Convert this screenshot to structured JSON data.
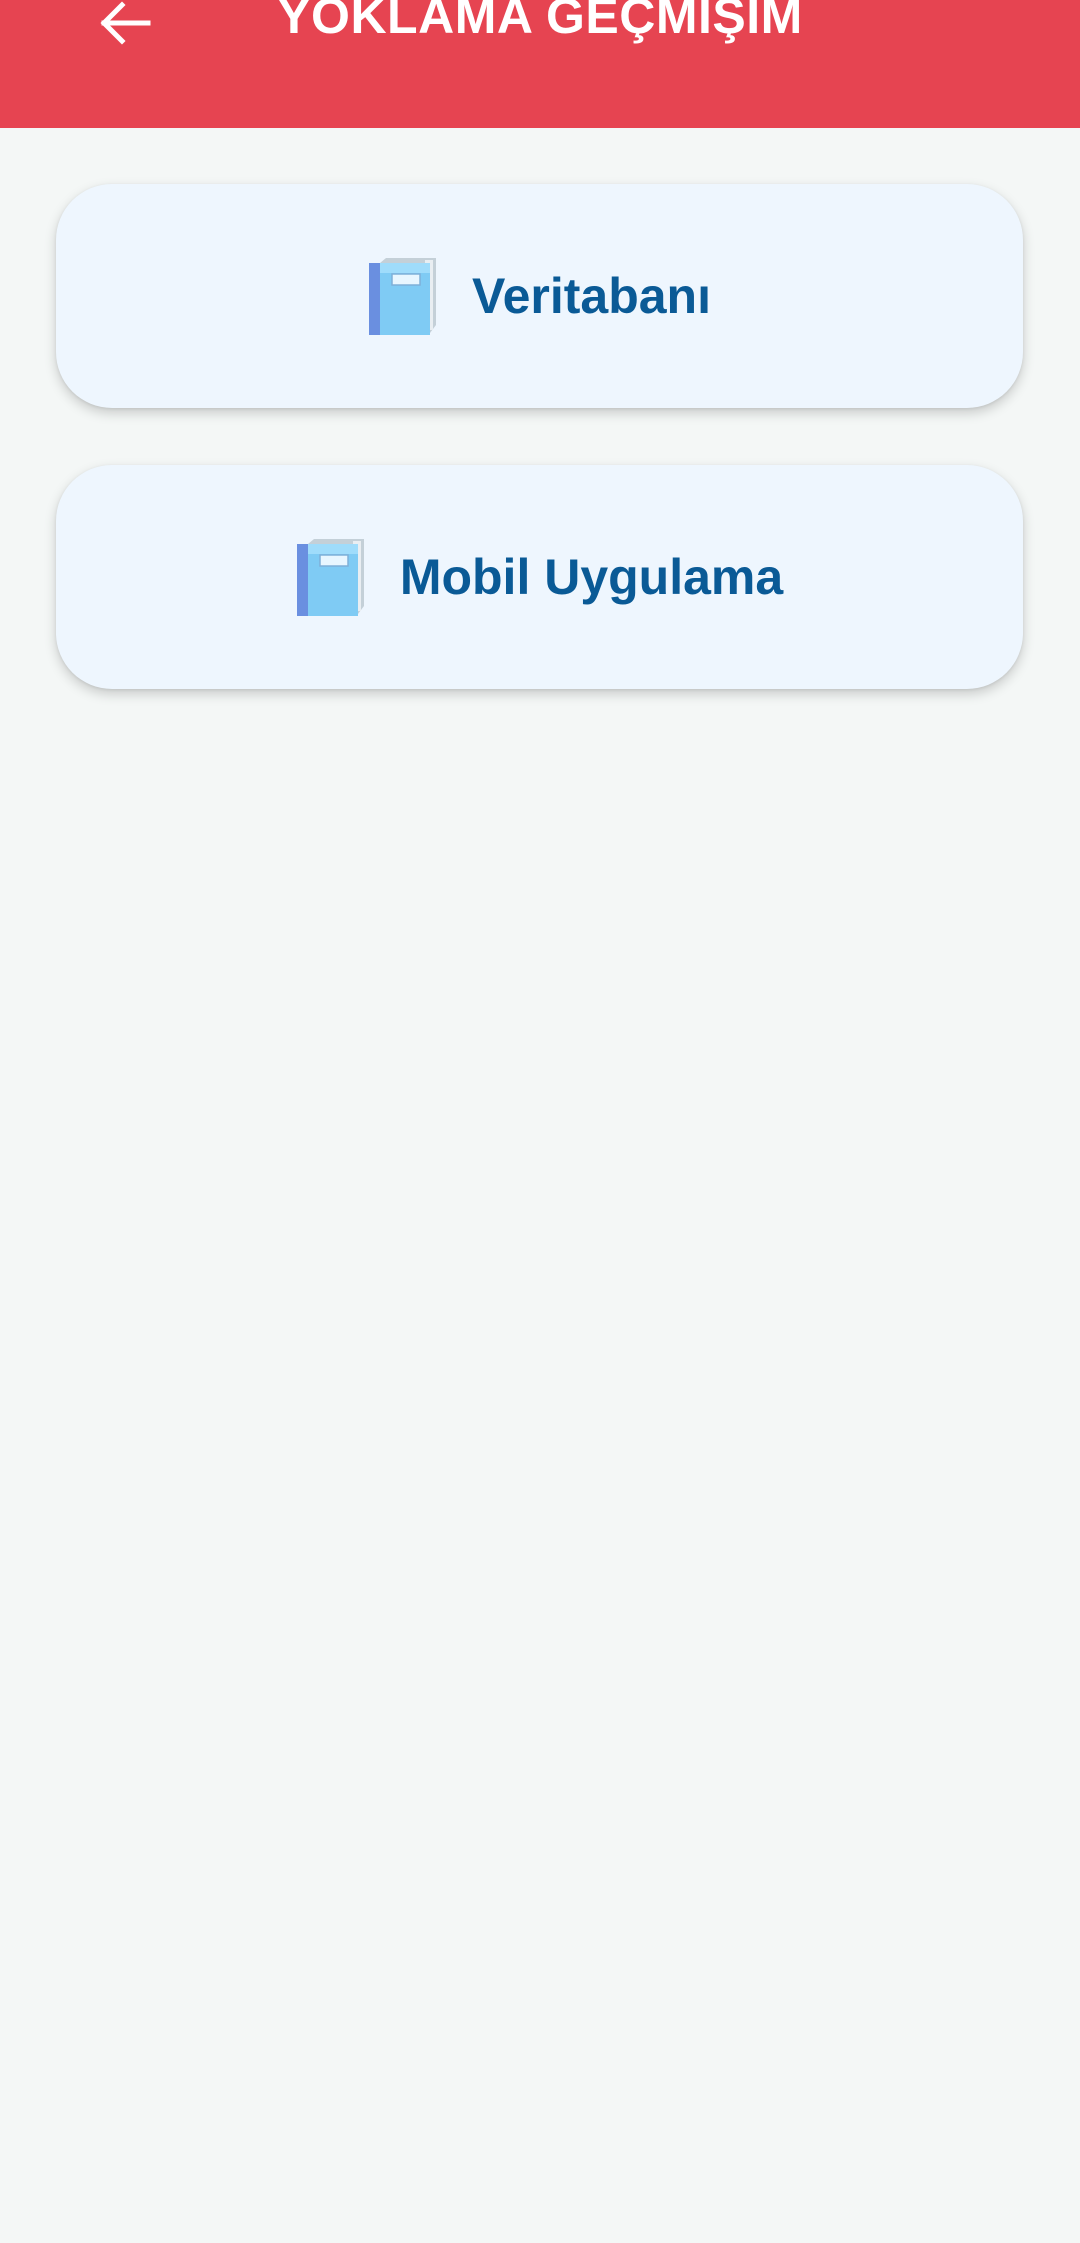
{
  "header": {
    "title": "YOKLAMA GEÇMİŞİM",
    "back_icon": "arrow-left-icon",
    "background_color": "#e64451"
  },
  "courses": [
    {
      "label": "Veritabanı",
      "icon": "blue-book-icon"
    },
    {
      "label": "Mobil Uygulama",
      "icon": "blue-book-icon"
    }
  ],
  "colors": {
    "page_background": "#f4f7f6",
    "card_background": "#eef6fe",
    "card_text": "#0a5a96"
  }
}
